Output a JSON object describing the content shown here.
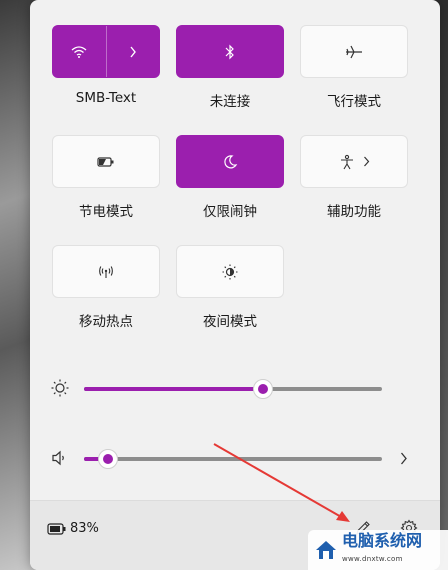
{
  "quick_settings": {
    "tiles": [
      {
        "name": "wifi",
        "label": "SMB-Text",
        "active": true,
        "icon": "wifi-icon",
        "expand_icon": "chevron-right-icon"
      },
      {
        "name": "bluetooth",
        "label": "未连接",
        "active": true,
        "icon": "bluetooth-icon"
      },
      {
        "name": "airplane",
        "label": "飞行模式",
        "active": false,
        "icon": "airplane-icon"
      },
      {
        "name": "battery-saver",
        "label": "节电模式",
        "active": false,
        "icon": "battery-saver-icon"
      },
      {
        "name": "focus-assist",
        "label": "仅限闹钟",
        "active": true,
        "icon": "moon-icon"
      },
      {
        "name": "accessibility",
        "label": "辅助功能",
        "active": false,
        "icon": "accessibility-icon",
        "expand_icon": "chevron-right-icon"
      },
      {
        "name": "hotspot",
        "label": "移动热点",
        "active": false,
        "icon": "hotspot-icon"
      },
      {
        "name": "night-light",
        "label": "夜间模式",
        "active": false,
        "icon": "night-light-icon"
      }
    ],
    "brightness": {
      "icon": "sun-icon",
      "level": 0.6
    },
    "volume": {
      "icon": "speaker-icon",
      "level": 0.08,
      "expand_icon": "chevron-right-icon"
    }
  },
  "footer": {
    "battery_icon": "battery-icon",
    "battery_text": "83%",
    "edit_icon": "pencil-icon",
    "settings_icon": "gear-icon"
  },
  "watermark": {
    "text": "电脑系统网",
    "url": "www.dnxtw.com"
  },
  "colors": {
    "accent": "#9b1fae",
    "panel": "#f1f1f1",
    "annotation_arrow": "#e53935"
  }
}
